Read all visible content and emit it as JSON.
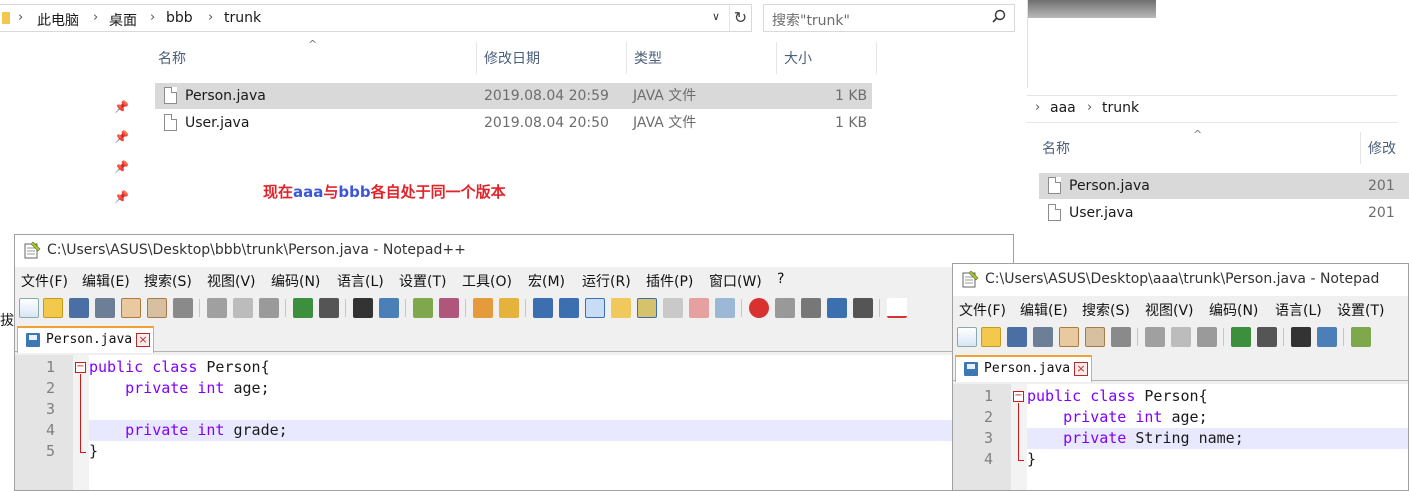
{
  "explorer_main": {
    "breadcrumb": [
      "此电脑",
      "桌面",
      "bbb",
      "trunk"
    ],
    "search_placeholder": "搜索\"trunk\"",
    "columns": {
      "name": "名称",
      "modified": "修改日期",
      "type": "类型",
      "size": "大小"
    },
    "files": [
      {
        "name": "Person.java",
        "modified": "2019.08.04 20:59",
        "type": "JAVA 文件",
        "size": "1 KB",
        "selected": true
      },
      {
        "name": "User.java",
        "modified": "2019.08.04 20:50",
        "type": "JAVA 文件",
        "size": "1 KB",
        "selected": false
      }
    ],
    "note": {
      "part1": "现在",
      "part2": "aaa",
      "part3": "与",
      "part4": "bbb",
      "part5": "各自处于同一个版本"
    }
  },
  "explorer_right": {
    "breadcrumb": [
      "aaa",
      "trunk"
    ],
    "columns": {
      "name": "名称",
      "modified": "修改"
    },
    "files": [
      {
        "name": "Person.java",
        "modified": "201",
        "selected": true
      },
      {
        "name": "User.java",
        "modified": "201",
        "selected": false
      }
    ]
  },
  "left_cut_char": "拔",
  "npp_left": {
    "title": "C:\\Users\\ASUS\\Desktop\\bbb\\trunk\\Person.java - Notepad++",
    "menus": [
      "文件(F)",
      "编辑(E)",
      "搜索(S)",
      "视图(V)",
      "编码(N)",
      "语言(L)",
      "设置(T)",
      "工具(O)",
      "宏(M)",
      "运行(R)",
      "插件(P)",
      "窗口(W)",
      "?"
    ],
    "tab": "Person.java",
    "lines": [
      {
        "n": "1",
        "kw": "public class",
        "rest": " Person{"
      },
      {
        "n": "2",
        "kw": "    private int",
        "rest": " age;"
      },
      {
        "n": "3",
        "kw": "",
        "rest": ""
      },
      {
        "n": "4",
        "kw": "    private int",
        "rest": " grade;"
      },
      {
        "n": "5",
        "kw": "",
        "rest": "}"
      }
    ],
    "current_line": 4
  },
  "npp_right": {
    "title": "C:\\Users\\ASUS\\Desktop\\aaa\\trunk\\Person.java - Notepad",
    "menus": [
      "文件(F)",
      "编辑(E)",
      "搜索(S)",
      "视图(V)",
      "编码(N)",
      "语言(L)",
      "设置(T)"
    ],
    "tab": "Person.java",
    "lines": [
      {
        "n": "1",
        "kw": "public class",
        "rest": " Person{"
      },
      {
        "n": "2",
        "kw": "    private int",
        "rest": " age;"
      },
      {
        "n": "3",
        "kw": "    private",
        "rest": " String name;"
      },
      {
        "n": "4",
        "kw": "",
        "rest": "}"
      }
    ],
    "current_line": 3
  },
  "colors": {
    "keyword": "#8000ff",
    "note_red": "#e0242b",
    "note_blue": "#3b57d8",
    "fold_red": "#d01a1a",
    "current_line": "#e8e8ff"
  }
}
